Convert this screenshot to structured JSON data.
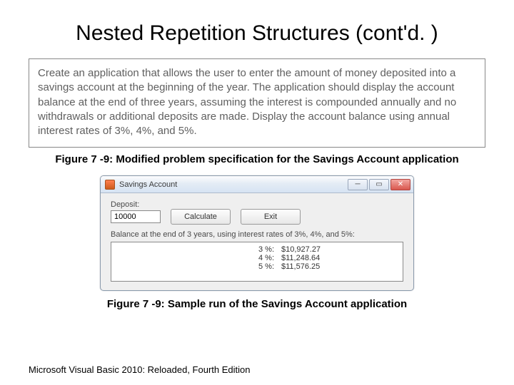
{
  "title": "Nested Repetition Structures (cont'd. )",
  "problem_text": "Create an application that allows the user to enter the amount of money deposited into a savings account at the beginning of the year. The application should display the account balance at the end of three years, assuming the interest is compounded annually and no withdrawals or additional deposits are made. Display the account balance using annual interest rates of 3%, 4%, and 5%.",
  "caption1": "Figure 7 -9: Modified problem specification for the Savings Account application",
  "caption2": "Figure 7 -9: Sample run of the Savings Account application",
  "footer": "Microsoft Visual Basic 2010: Reloaded, Fourth Edition",
  "app": {
    "window_title": "Savings Account",
    "deposit_label": "Deposit:",
    "deposit_value": "10000",
    "calc_label": "Calculate",
    "exit_label": "Exit",
    "balance_label": "Balance at the end of 3 years, using interest rates of 3%, 4%, and 5%:",
    "results": [
      {
        "rate": "3 %:",
        "value": "$10,927.27"
      },
      {
        "rate": "4 %:",
        "value": "$11,248.64"
      },
      {
        "rate": "5 %:",
        "value": "$11,576.25"
      }
    ]
  }
}
